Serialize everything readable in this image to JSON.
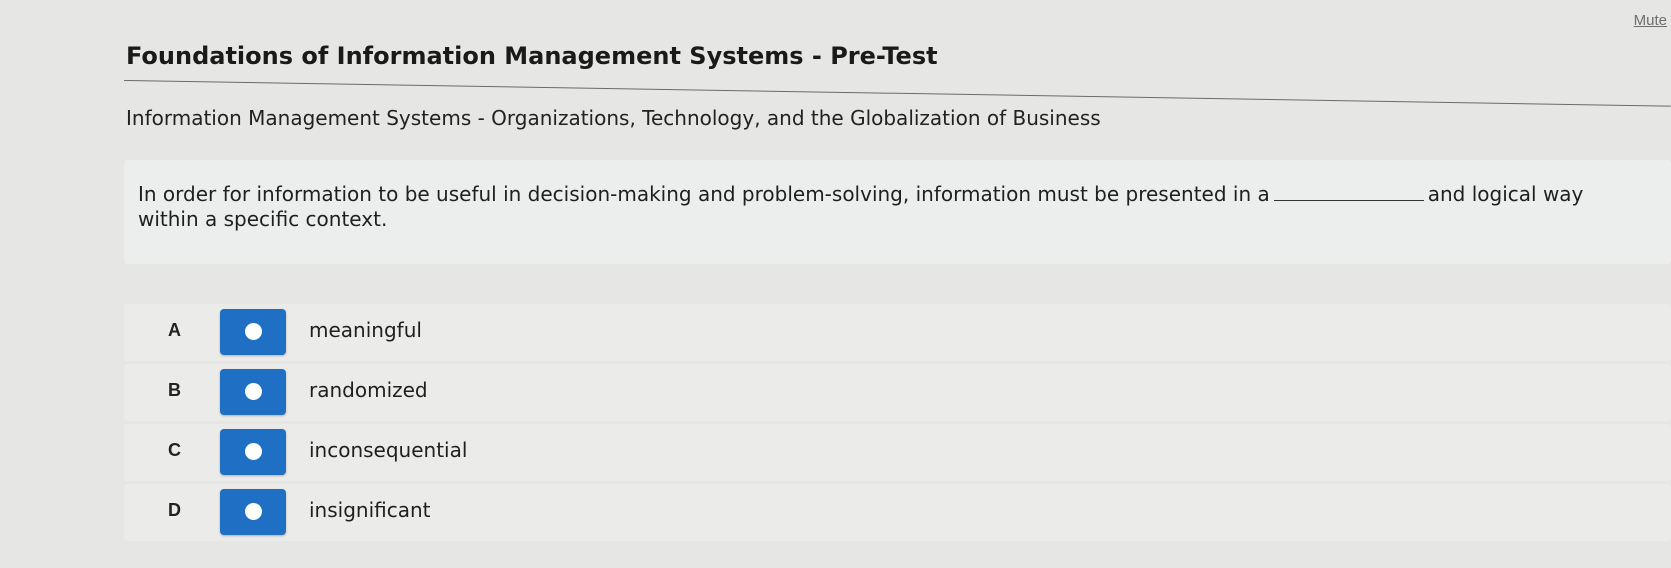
{
  "header": {
    "mute_label": "Mute",
    "title": "Foundations of Information Management Systems - Pre-Test",
    "subtitle": "Information Management Systems - Organizations, Technology, and the Globalization of Business"
  },
  "question": {
    "text_before_blank": "In order for information to be useful in decision-making and problem-solving, information must be presented in a",
    "text_after_blank": "and logical way",
    "text_line2": "within a specific context."
  },
  "options": [
    {
      "letter": "A",
      "text": "meaningful"
    },
    {
      "letter": "B",
      "text": "randomized"
    },
    {
      "letter": "C",
      "text": "inconsequential"
    },
    {
      "letter": "D",
      "text": "insignificant"
    }
  ],
  "colors": {
    "radio_button": "#1f6fc5",
    "page_background": "#e6e7e4"
  }
}
